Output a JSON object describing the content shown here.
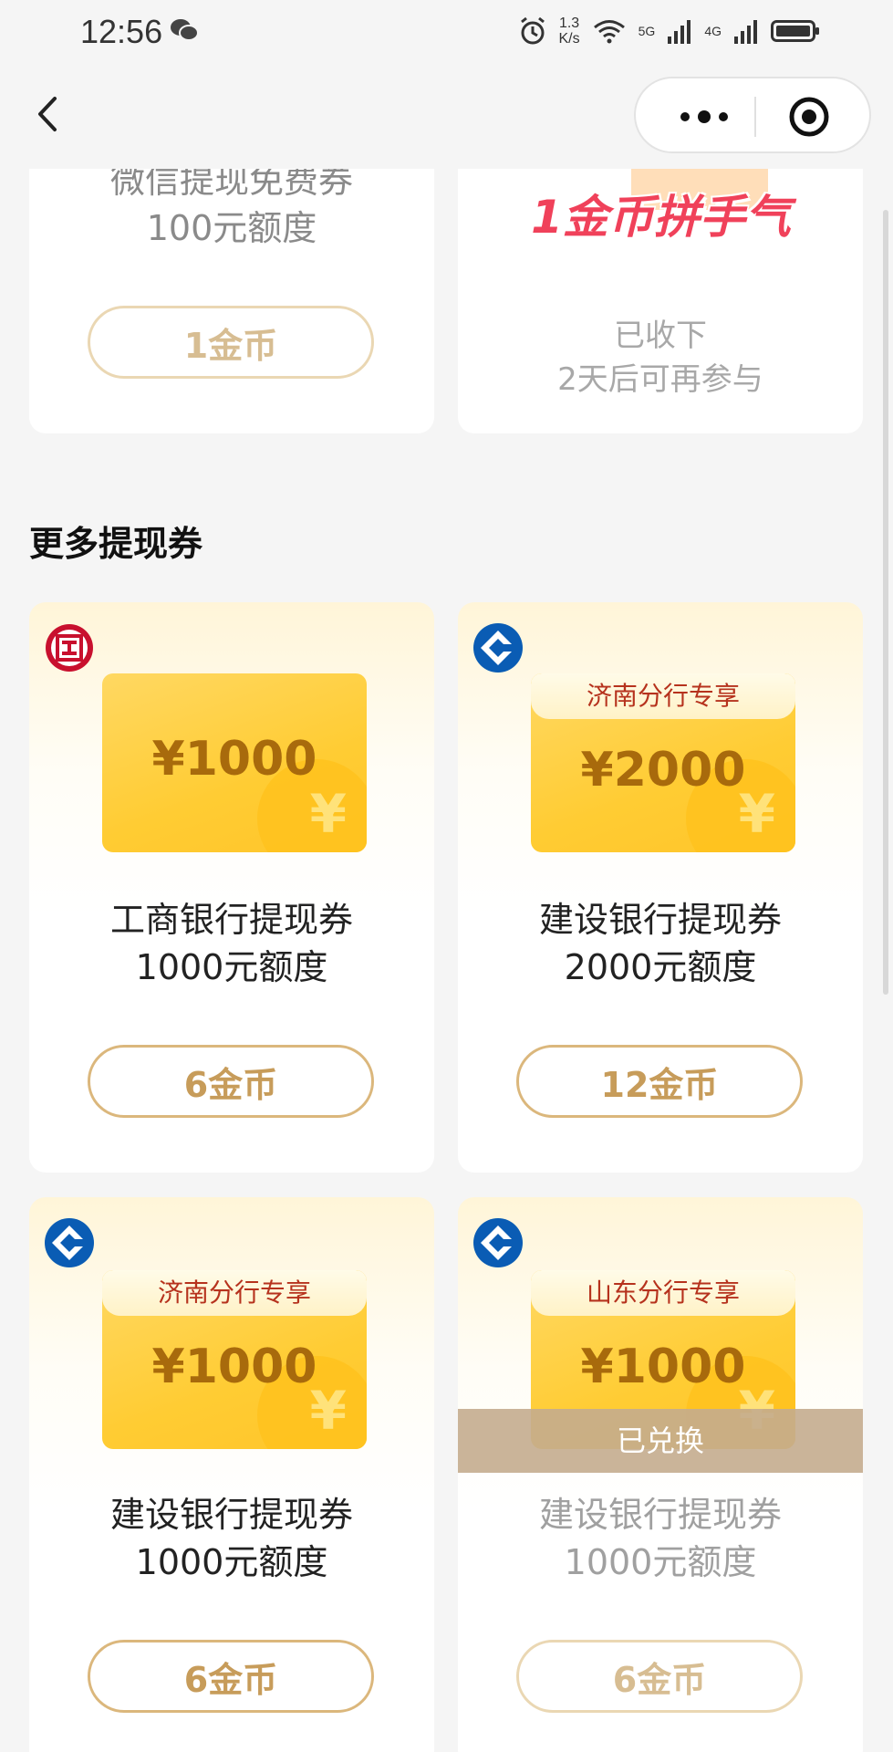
{
  "status_bar": {
    "time": "12:56",
    "speed_value": "1.3",
    "speed_unit": "K/s",
    "sim1": "5G",
    "sim2": "4G"
  },
  "nav": {
    "back_icon": "chevron-left-icon",
    "more_icon": "more-dots-icon",
    "close_icon": "target-close-icon"
  },
  "top_cards": [
    {
      "title_line1": "微信提现免费券",
      "title_line2": "100元额度",
      "button": "1金币"
    },
    {
      "banner_text": "1金币拼手气",
      "status_line1": "已收下",
      "status_line2": "2天后可再参与"
    }
  ],
  "section_title": "更多提现券",
  "vouchers": [
    {
      "bank": "icbc",
      "tag": "",
      "amount": "¥1000",
      "name": "工商银行提现券",
      "quota": "1000元额度",
      "button": "6金币",
      "redeemed_label": ""
    },
    {
      "bank": "ccb",
      "tag": "济南分行专享",
      "amount": "¥2000",
      "name": "建设银行提现券",
      "quota": "2000元额度",
      "button": "12金币",
      "redeemed_label": ""
    },
    {
      "bank": "ccb",
      "tag": "济南分行专享",
      "amount": "¥1000",
      "name": "建设银行提现券",
      "quota": "1000元额度",
      "button": "6金币",
      "redeemed_label": ""
    },
    {
      "bank": "ccb",
      "tag": "山东分行专享",
      "amount": "¥1000",
      "name": "建设银行提现券",
      "quota": "1000元额度",
      "button": "6金币",
      "redeemed_label": "已兑换"
    }
  ],
  "coin_symbol": "¥",
  "colors": {
    "gold_border": "#dbb77c",
    "gold_text": "#c79c5a",
    "voucher_yellow": "#ffcc33",
    "tag_red": "#b6321d",
    "ccb_blue": "#0a5cb4",
    "icbc_red": "#c8102e"
  }
}
